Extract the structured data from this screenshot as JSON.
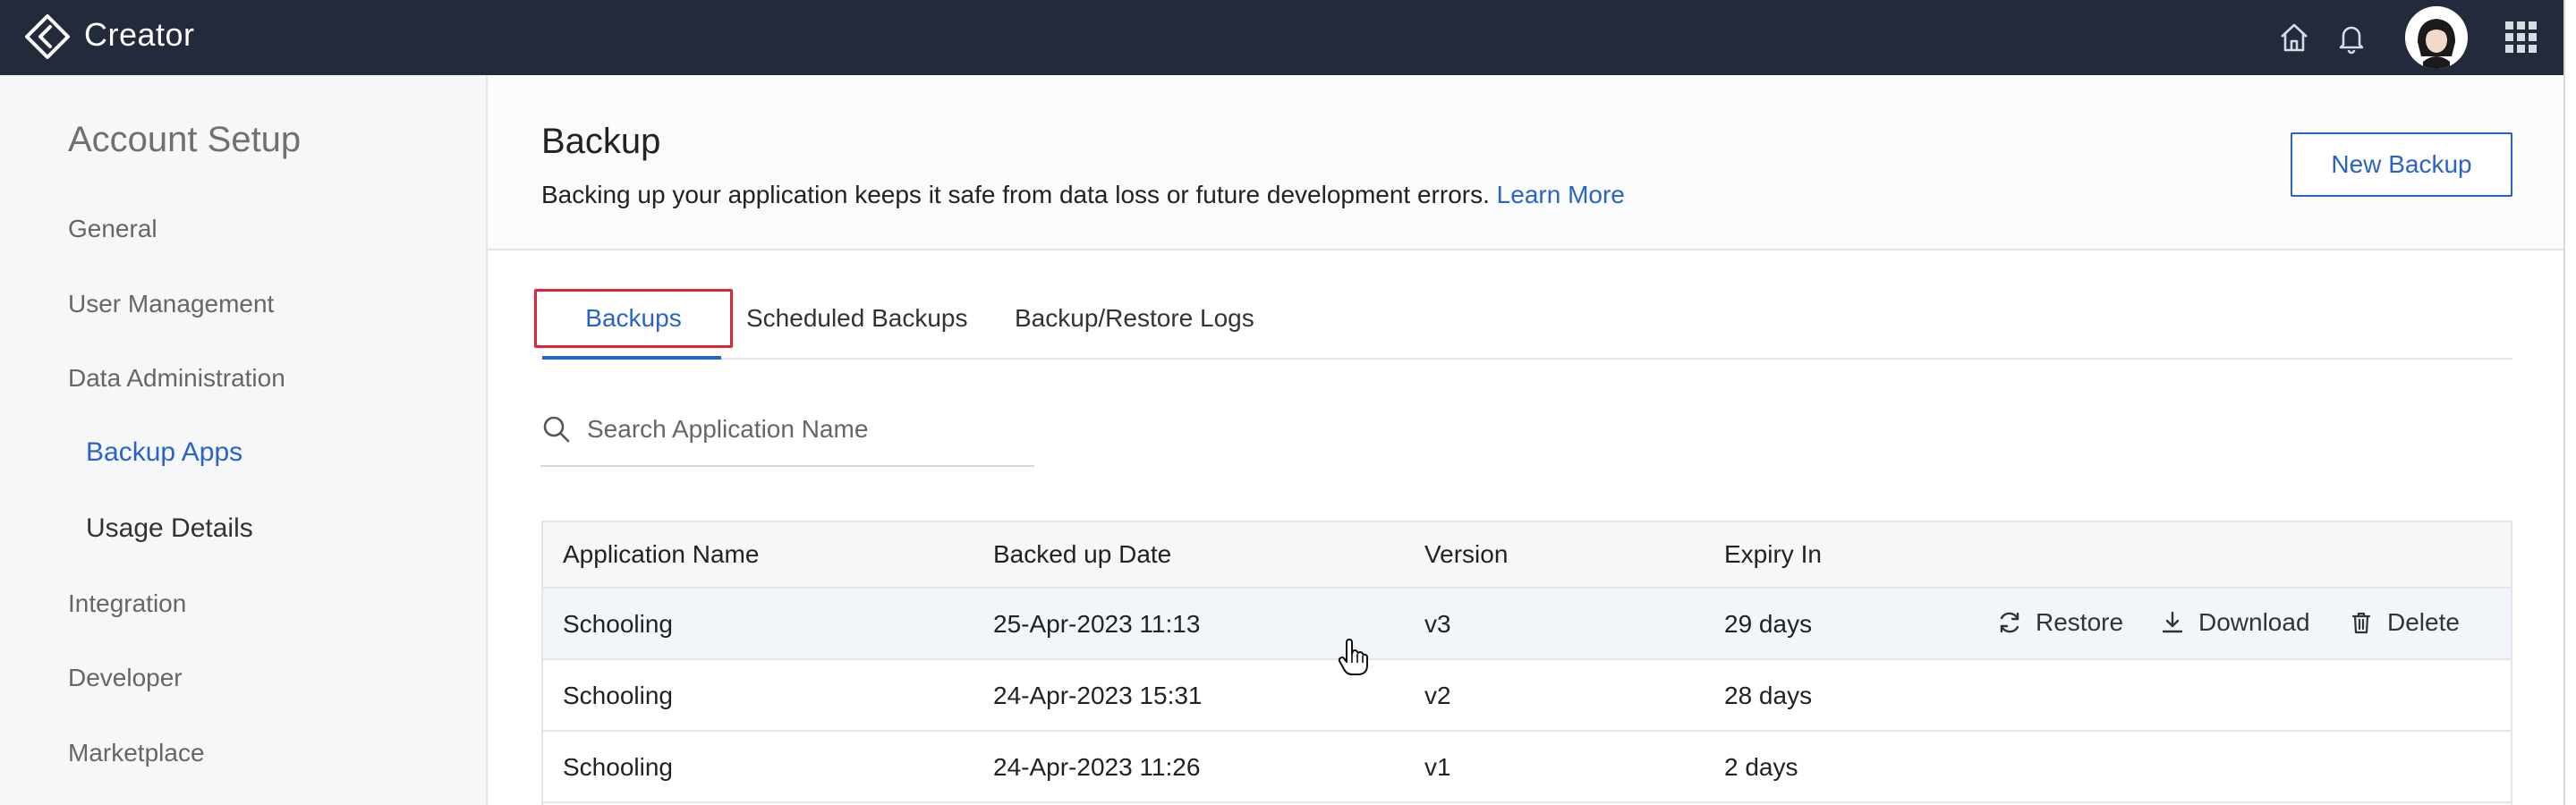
{
  "app": {
    "brand": "Creator"
  },
  "topbar": {
    "icons": [
      "home-icon",
      "bell-icon",
      "avatar",
      "apps-grid-icon"
    ]
  },
  "sidebar": {
    "title": "Account Setup",
    "items": [
      {
        "label": "General"
      },
      {
        "label": "User Management"
      },
      {
        "label": "Data Administration"
      },
      {
        "label": "Backup Apps"
      },
      {
        "label": "Usage Details"
      },
      {
        "label": "Integration"
      },
      {
        "label": "Developer"
      },
      {
        "label": "Marketplace"
      }
    ]
  },
  "header": {
    "title": "Backup",
    "description": "Backing up your application keeps it safe from data loss or future development errors.",
    "learn_more": "Learn More",
    "new_backup": "New Backup"
  },
  "tabs": [
    {
      "label": "Backups",
      "active": true
    },
    {
      "label": "Scheduled Backups",
      "active": false
    },
    {
      "label": "Backup/Restore Logs",
      "active": false
    }
  ],
  "search": {
    "placeholder": "Search Application Name",
    "value": ""
  },
  "table": {
    "columns": [
      "Application Name",
      "Backed up Date",
      "Version",
      "Expiry In"
    ],
    "rows": [
      [
        "Schooling",
        "25-Apr-2023 11:13",
        "v3",
        "29 days"
      ],
      [
        "Schooling",
        "24-Apr-2023 15:31",
        "v2",
        "28 days"
      ],
      [
        "Schooling",
        "24-Apr-2023 11:26",
        "v1",
        "2 days"
      ]
    ],
    "actions": [
      "Restore",
      "Download",
      "Delete"
    ]
  },
  "colors": {
    "topbar": "#232a3b",
    "accent": "#2a63c6",
    "highlight": "#e02434"
  }
}
